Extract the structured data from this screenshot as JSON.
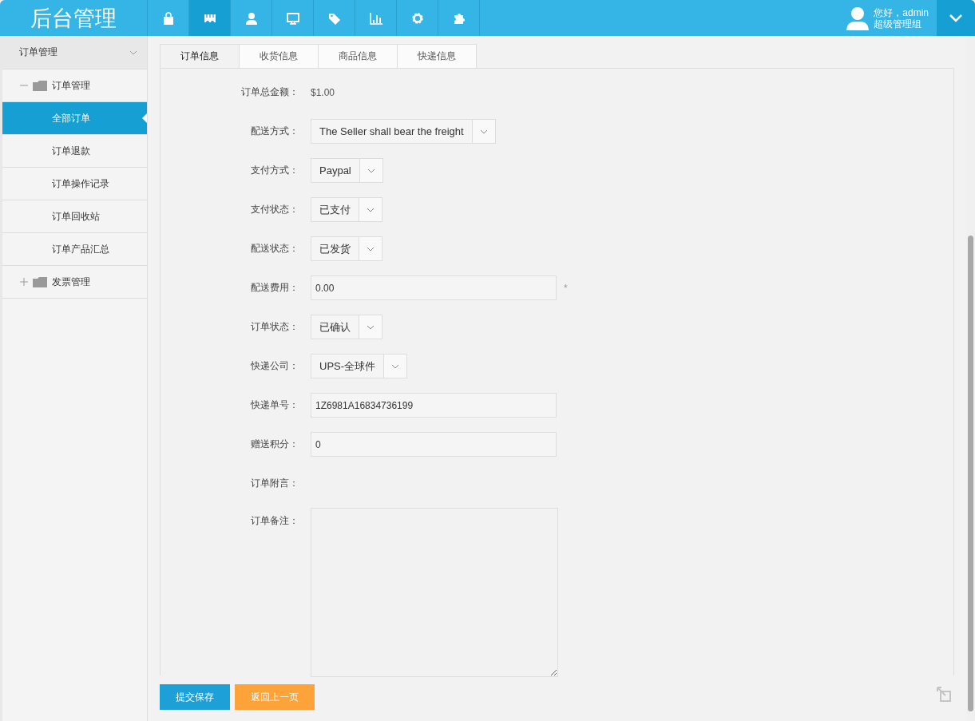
{
  "header": {
    "title": "后台管理",
    "nav": [
      {
        "selected": false
      },
      {
        "selected": true
      },
      {
        "selected": false
      },
      {
        "selected": false
      },
      {
        "selected": false
      },
      {
        "selected": false
      },
      {
        "selected": false
      },
      {
        "selected": false
      }
    ],
    "user": {
      "greeting": "您好，admin",
      "role": "超级管理组"
    }
  },
  "sidebar": {
    "section": {
      "label": "订单管理",
      "expanded": true
    },
    "groups": [
      {
        "label": "订单管理",
        "expanded": true,
        "children": [
          {
            "label": "全部订单",
            "selected": true
          },
          {
            "label": "订单退款",
            "selected": false
          },
          {
            "label": "订单操作记录",
            "selected": false
          },
          {
            "label": "订单回收站",
            "selected": false
          },
          {
            "label": "订单产品汇总",
            "selected": false
          }
        ]
      },
      {
        "label": "发票管理",
        "expanded": false
      }
    ]
  },
  "tabs": [
    {
      "label": "订单信息",
      "selected": true
    },
    {
      "label": "收货信息",
      "selected": false
    },
    {
      "label": "商品信息",
      "selected": false
    },
    {
      "label": "快递信息",
      "selected": false
    }
  ],
  "form": {
    "fields": [
      {
        "kind": "text",
        "label": "订单总金额：",
        "value": "$1.00"
      },
      {
        "kind": "select",
        "label": "配送方式：",
        "value": "The Seller shall bear the freight"
      },
      {
        "kind": "select",
        "label": "支付方式：",
        "value": "Paypal"
      },
      {
        "kind": "select",
        "label": "支付状态：",
        "value": "已支付"
      },
      {
        "kind": "select",
        "label": "配送状态：",
        "value": "已发货"
      },
      {
        "kind": "input",
        "label": "配送费用：",
        "value": "0.00",
        "required": "*"
      },
      {
        "kind": "select",
        "label": "订单状态：",
        "value": "已确认"
      },
      {
        "kind": "select",
        "label": "快递公司：",
        "value": "UPS-全球件"
      },
      {
        "kind": "input",
        "label": "快递单号：",
        "value": "1Z6981A16834736199"
      },
      {
        "kind": "input",
        "label": "赠送积分：",
        "value": "0"
      },
      {
        "kind": "text",
        "label": "订单附言："
      },
      {
        "kind": "textarea",
        "label": "订单备注："
      }
    ]
  },
  "buttons": [
    {
      "label": "提交保存",
      "kind": "primary"
    },
    {
      "label": "返回上一页",
      "kind": "secondary"
    }
  ]
}
